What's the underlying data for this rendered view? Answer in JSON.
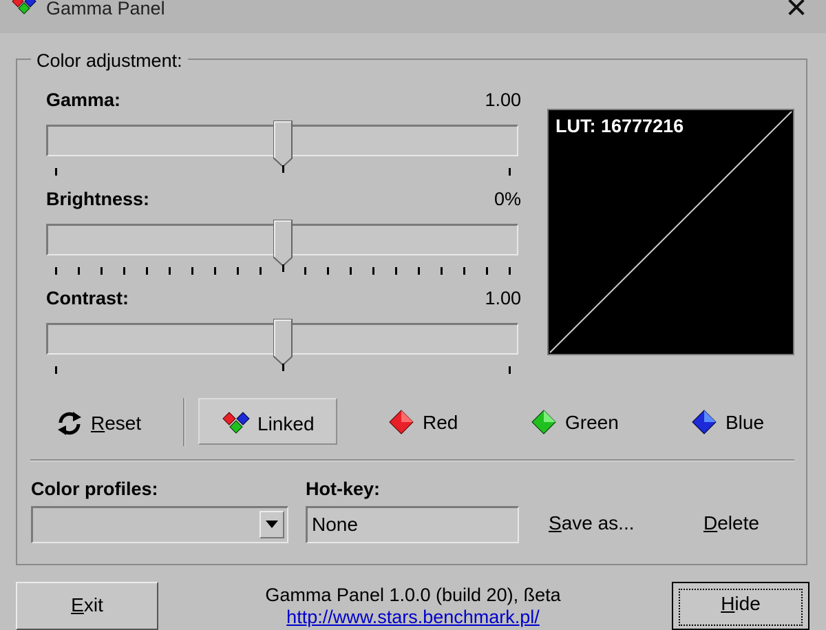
{
  "window": {
    "title": "Gamma Panel",
    "close_glyph": "✕"
  },
  "group": {
    "legend": "Color adjustment:"
  },
  "sliders": {
    "gamma": {
      "label": "Gamma:",
      "value_text": "1.00",
      "fraction": 0.5
    },
    "brightness": {
      "label": "Brightness:",
      "value_text": "0%",
      "fraction": 0.5
    },
    "contrast": {
      "label": "Contrast:",
      "value_text": "1.00",
      "fraction": 0.5
    }
  },
  "lut": {
    "label": "LUT: 16777216"
  },
  "channel_buttons": {
    "reset": {
      "mnemonic": "R",
      "rest": "eset",
      "icon": "refresh-icon"
    },
    "linked": {
      "label": "Linked",
      "icon": "linked-diamonds-icon"
    },
    "red": {
      "label": "Red",
      "icon": "red-diamond-icon",
      "color": "#e8202a"
    },
    "green": {
      "label": "Green",
      "icon": "green-diamond-icon",
      "color": "#20c020"
    },
    "blue": {
      "label": "Blue",
      "icon": "blue-diamond-icon",
      "color": "#1c2ad8"
    }
  },
  "profiles": {
    "label": "Color profiles:",
    "selected": ""
  },
  "hotkey": {
    "label": "Hot-key:",
    "value": "None"
  },
  "actions": {
    "save_as": {
      "mnemonic": "S",
      "rest": "ave as..."
    },
    "delete": {
      "mnemonic": "D",
      "rest": "elete"
    }
  },
  "footer": {
    "exit": {
      "mnemonic": "E",
      "rest": "xit"
    },
    "hide": {
      "mnemonic": "H",
      "rest": "ide"
    },
    "version": "Gamma Panel 1.0.0 (build 20), ßeta",
    "url": "http://www.stars.benchmark.pl/"
  }
}
